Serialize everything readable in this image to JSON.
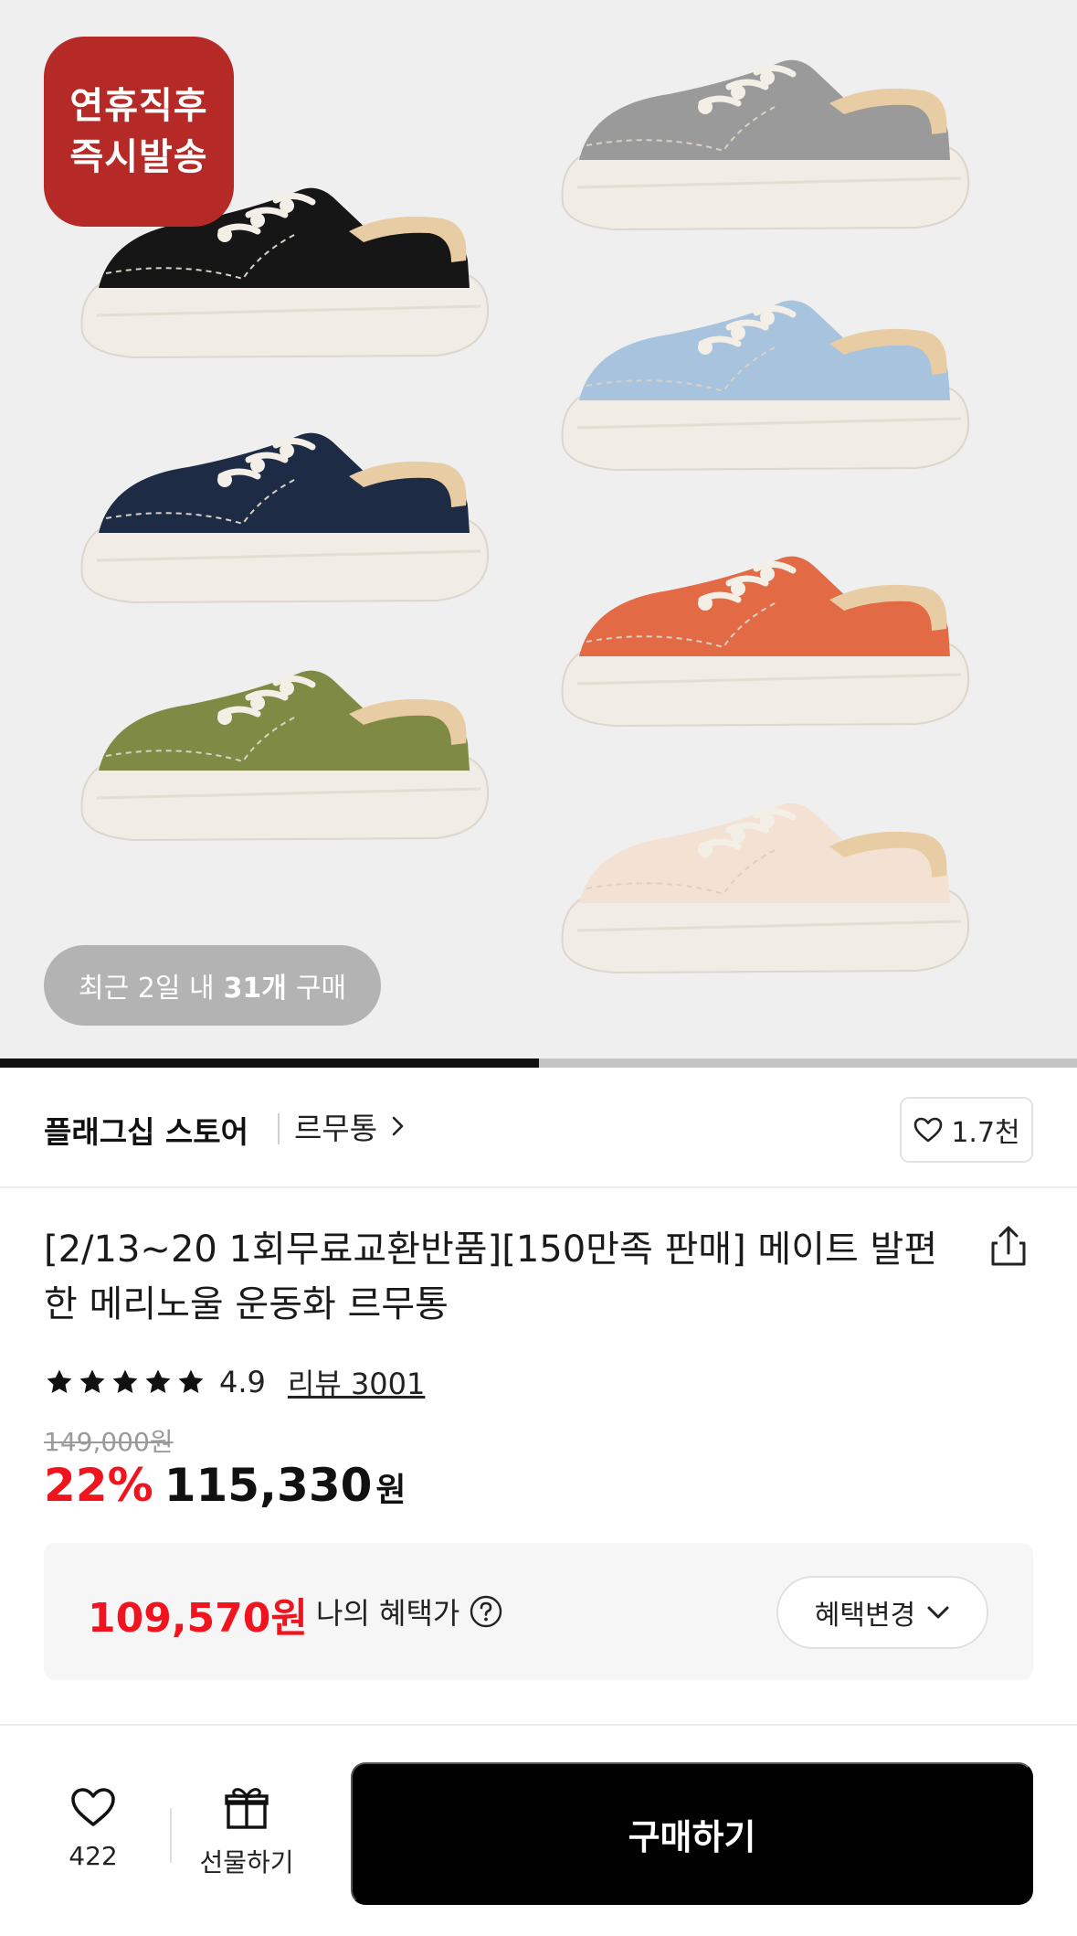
{
  "hero": {
    "promo_line1": "연휴직후",
    "promo_line2": "즉시발송",
    "recent_prefix": "최근 2일 내",
    "recent_count": "31개",
    "recent_suffix": "구매",
    "carousel_progress": 0.5,
    "shoe_colors": [
      "#161616",
      "#1e2b44",
      "#7f8b44",
      "#9a9a9a",
      "#a7c3dd",
      "#e26a45",
      "#f3e2d3"
    ]
  },
  "store": {
    "name": "플래그십 스토어",
    "brand": "르무통",
    "like_count": "1.7천"
  },
  "product": {
    "title": "[2/13~20 1회무료교환반품][150만족 판매] 메이트 발편한 메리노울 운동화 르무통",
    "rating": "4.9",
    "stars": 5,
    "review_label": "리뷰 3001",
    "original_price": "149,000원",
    "discount": "22%",
    "sale_price": "115,330",
    "currency": "원"
  },
  "benefit": {
    "price": "109,570원",
    "label": "나의 혜택가",
    "button_label": "혜택변경"
  },
  "bottom": {
    "wish_count": "422",
    "gift_label": "선물하기",
    "buy_label": "구매하기"
  },
  "colors": {
    "accent_red": "#f0141f",
    "promo_red": "#b52a26"
  }
}
